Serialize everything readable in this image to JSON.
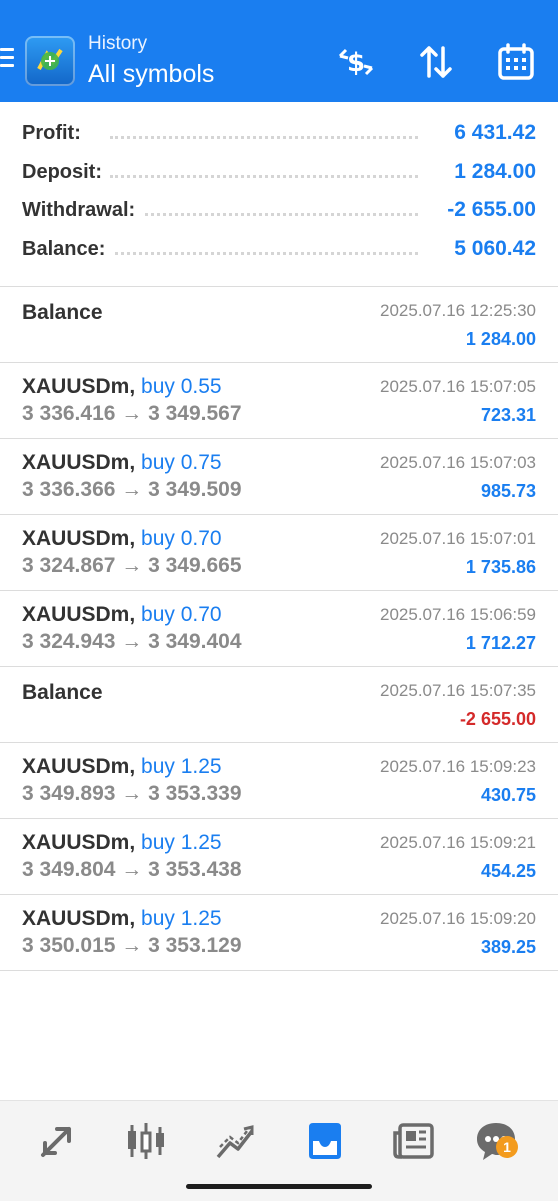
{
  "header": {
    "subtitle": "History",
    "title": "All symbols"
  },
  "summary": [
    {
      "label": "Profit:",
      "value": "6 431.42"
    },
    {
      "label": "Deposit:",
      "value": "1 284.00"
    },
    {
      "label": "Withdrawal:",
      "value": "-2 655.00"
    },
    {
      "label": "Balance:",
      "value": "5 060.42"
    }
  ],
  "deals": [
    {
      "kind": "balance",
      "title": "Balance",
      "time": "2025.07.16 12:25:30",
      "profit": "1 284.00"
    },
    {
      "kind": "trade",
      "symbol": "XAUUSDm,",
      "side": "buy 0.55",
      "prices": "3 336.416 → 3 349.567",
      "time": "2025.07.16 15:07:05",
      "profit": "723.31"
    },
    {
      "kind": "trade",
      "symbol": "XAUUSDm,",
      "side": "buy 0.75",
      "prices": "3 336.366 → 3 349.509",
      "time": "2025.07.16 15:07:03",
      "profit": "985.73"
    },
    {
      "kind": "trade",
      "symbol": "XAUUSDm,",
      "side": "buy 0.70",
      "prices": "3 324.867 → 3 349.665",
      "time": "2025.07.16 15:07:01",
      "profit": "1 735.86"
    },
    {
      "kind": "trade",
      "symbol": "XAUUSDm,",
      "side": "buy 0.70",
      "prices": "3 324.943 → 3 349.404",
      "time": "2025.07.16 15:06:59",
      "profit": "1 712.27"
    },
    {
      "kind": "balance",
      "title": "Balance",
      "time": "2025.07.16 15:07:35",
      "profit": "-2 655.00"
    },
    {
      "kind": "trade",
      "symbol": "XAUUSDm,",
      "side": "buy 1.25",
      "prices": "3 349.893 → 3 353.339",
      "time": "2025.07.16 15:09:23",
      "profit": "430.75"
    },
    {
      "kind": "trade",
      "symbol": "XAUUSDm,",
      "side": "buy 1.25",
      "prices": "3 349.804 → 3 353.438",
      "time": "2025.07.16 15:09:21",
      "profit": "454.25"
    },
    {
      "kind": "trade",
      "symbol": "XAUUSDm,",
      "side": "buy 1.25",
      "prices": "3 350.015 → 3 353.129",
      "time": "2025.07.16 15:09:20",
      "profit": "389.25"
    }
  ],
  "bottom_nav": {
    "items": [
      "quotes-icon",
      "chart-icon",
      "trade-icon",
      "history-icon",
      "news-icon",
      "chat-icon"
    ],
    "active": "history-icon",
    "chat_badge": "1"
  },
  "colors": {
    "accent": "#1a7ef0",
    "negative": "#d42a2a",
    "badge": "#f39b1d"
  }
}
